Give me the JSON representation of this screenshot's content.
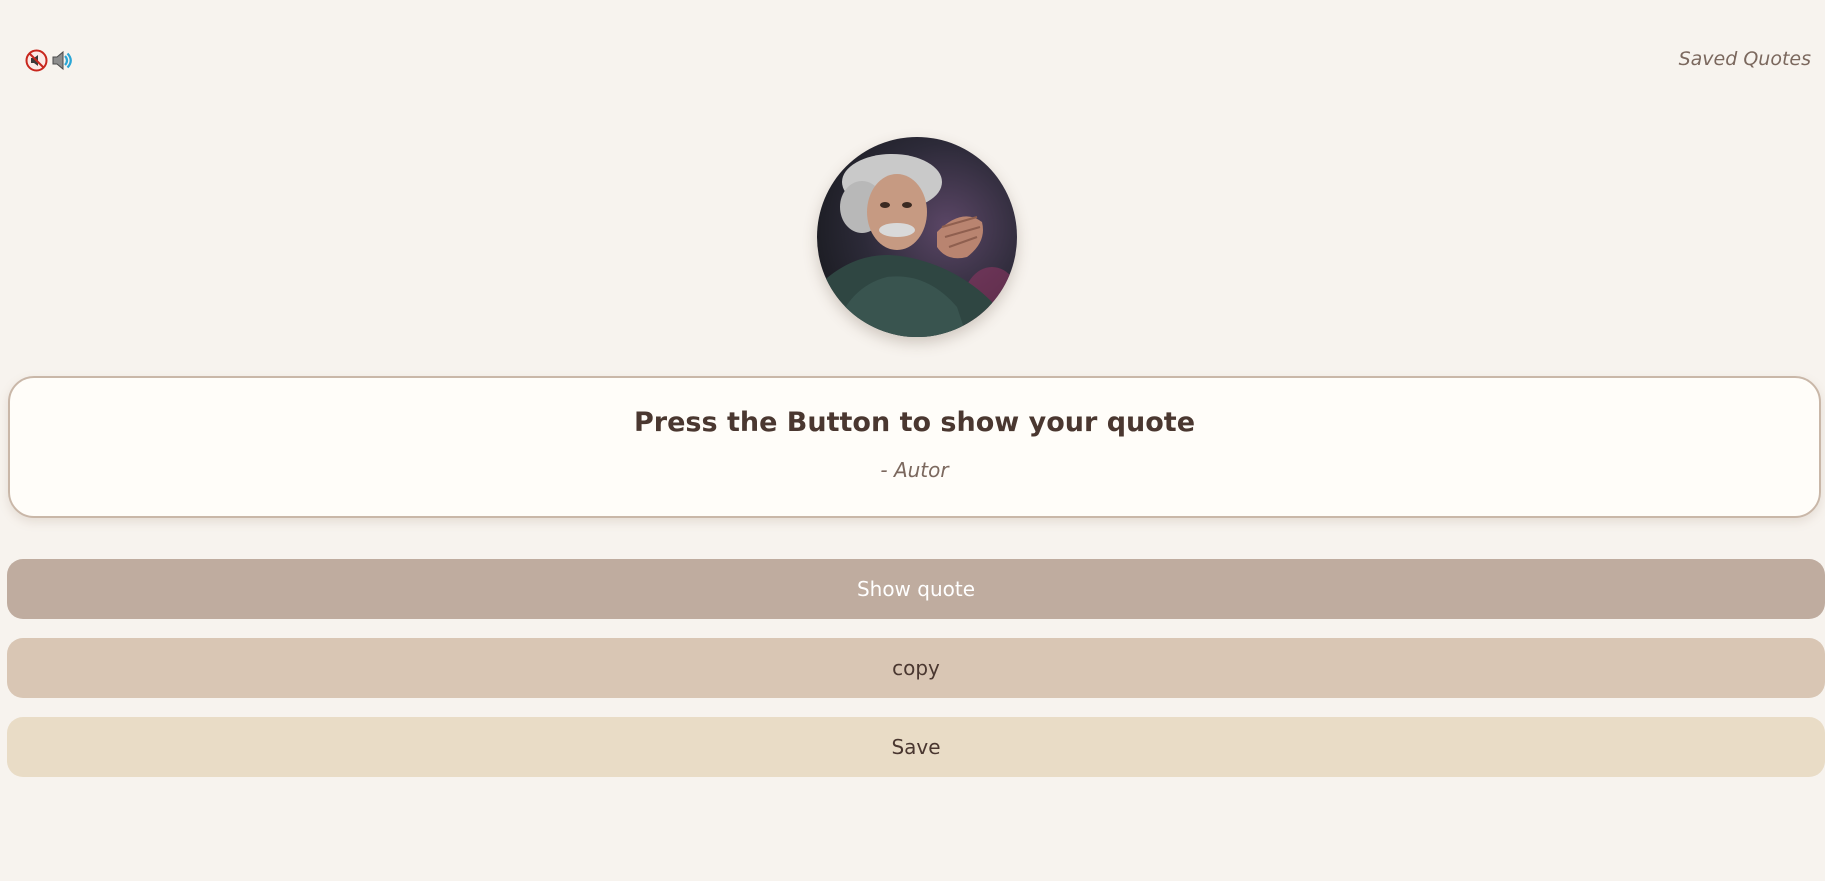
{
  "header": {
    "saved_link": "Saved Quotes",
    "icons": [
      "mute-icon",
      "speaker-icon"
    ]
  },
  "quote": {
    "text": "Press the Button to show your quote",
    "author": "- Autor"
  },
  "buttons": {
    "show": "Show quote",
    "copy": "copy",
    "save": "Save"
  },
  "colors": {
    "background": "#f7f3ee",
    "card": "#fffdf9",
    "card_border": "#c9b7a8",
    "show_button": "#bfac9f",
    "copy_button": "#d9c6b4",
    "save_button": "#e9dcc6",
    "text_dark": "#4a3730",
    "text_muted": "#7b685e"
  }
}
